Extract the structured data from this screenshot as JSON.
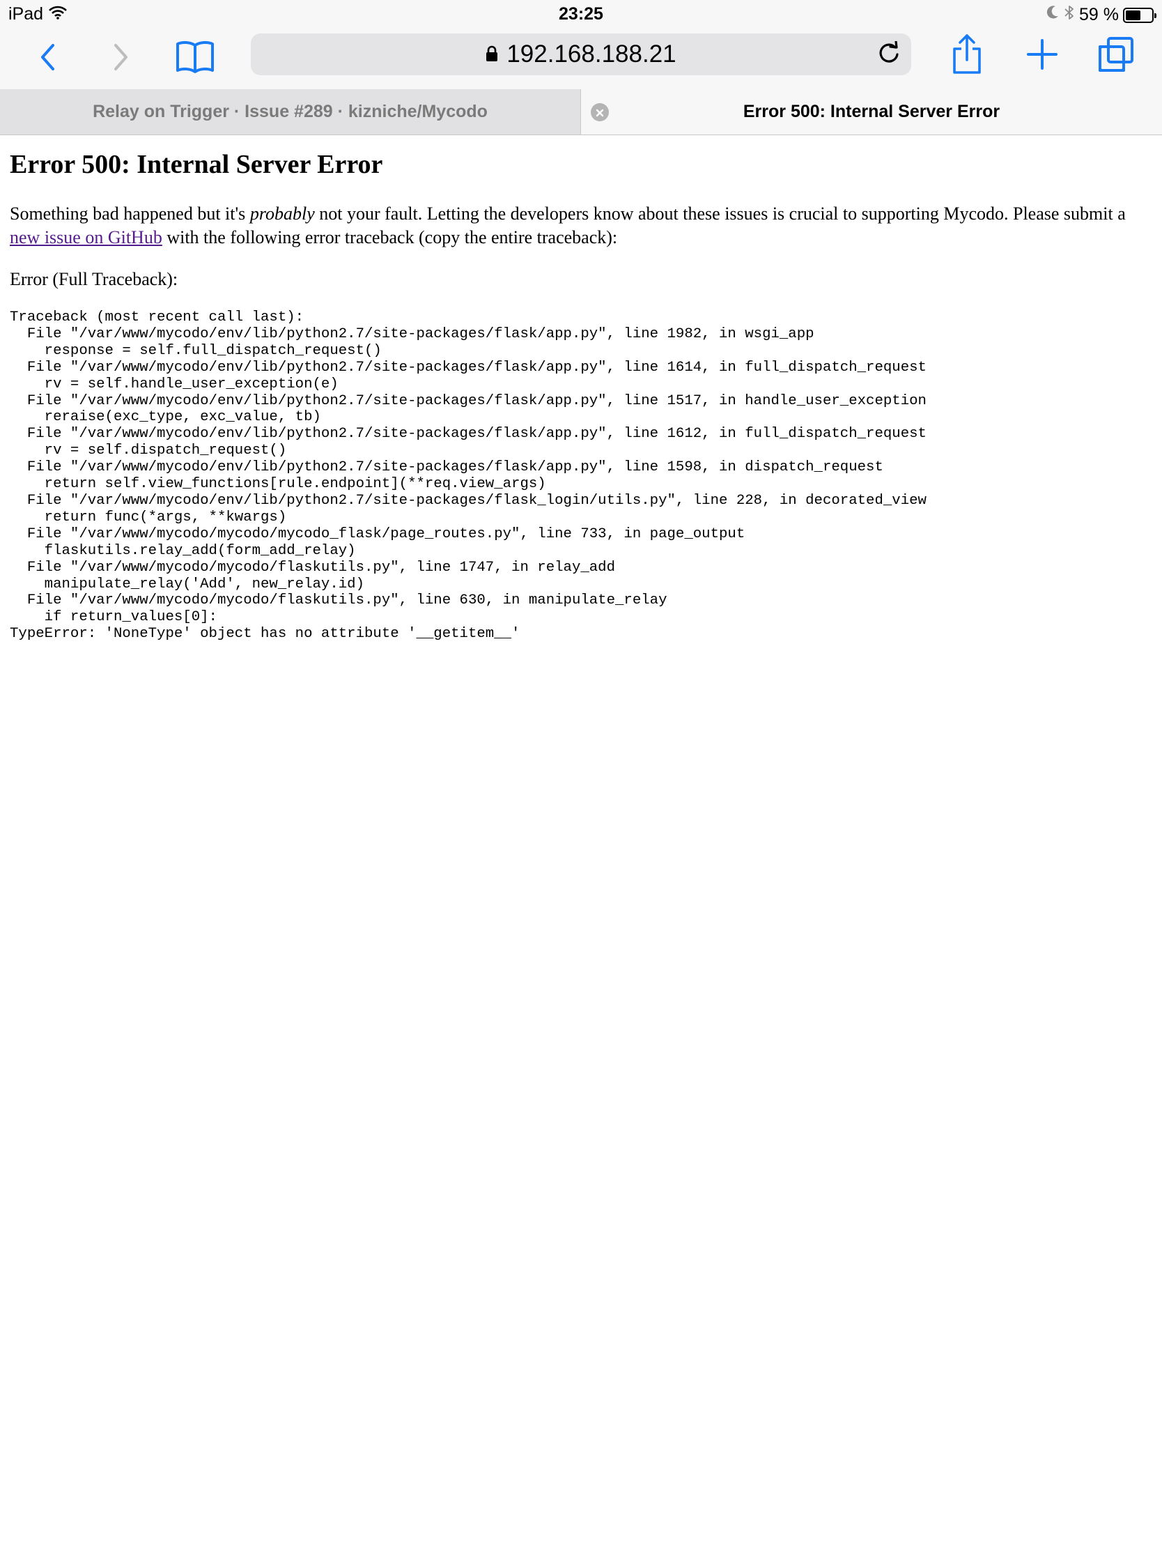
{
  "status_bar": {
    "device": "iPad",
    "time": "23:25",
    "battery_text": "59 %",
    "battery_level": 0.59,
    "icons": [
      "wifi-icon",
      "moon-icon",
      "bluetooth-icon",
      "battery-icon"
    ]
  },
  "toolbar": {
    "address": "192.168.188.21",
    "icons": [
      "back-icon",
      "forward-icon",
      "bookmarks-icon",
      "lock-icon",
      "reload-icon",
      "share-icon",
      "new-tab-icon",
      "tabs-icon"
    ],
    "accent_color": "#1a7cf5"
  },
  "tabs": [
    {
      "title": "Relay on Trigger · Issue #289 · kizniche/Mycodo",
      "active": false
    },
    {
      "title": "Error 500: Internal Server Error",
      "active": true
    }
  ],
  "page": {
    "heading": "Error 500: Internal Server Error",
    "intro_part1": "Something bad happened but it's ",
    "intro_emphasis": "probably",
    "intro_part2": " not your fault. Letting the developers know about these issues is crucial to supporting Mycodo. Please submit a ",
    "intro_link": "new issue on GitHub",
    "intro_part3": " with the following error traceback (copy the entire traceback):",
    "traceback_label": "Error (Full Traceback):",
    "traceback_lines": [
      "Traceback (most recent call last):",
      "  File \"/var/www/mycodo/env/lib/python2.7/site-packages/flask/app.py\", line 1982, in wsgi_app",
      "    response = self.full_dispatch_request()",
      "  File \"/var/www/mycodo/env/lib/python2.7/site-packages/flask/app.py\", line 1614, in full_dispatch_request",
      "    rv = self.handle_user_exception(e)",
      "  File \"/var/www/mycodo/env/lib/python2.7/site-packages/flask/app.py\", line 1517, in handle_user_exception",
      "    reraise(exc_type, exc_value, tb)",
      "  File \"/var/www/mycodo/env/lib/python2.7/site-packages/flask/app.py\", line 1612, in full_dispatch_request",
      "    rv = self.dispatch_request()",
      "  File \"/var/www/mycodo/env/lib/python2.7/site-packages/flask/app.py\", line 1598, in dispatch_request",
      "    return self.view_functions[rule.endpoint](**req.view_args)",
      "  File \"/var/www/mycodo/env/lib/python2.7/site-packages/flask_login/utils.py\", line 228, in decorated_view",
      "    return func(*args, **kwargs)",
      "  File \"/var/www/mycodo/mycodo/mycodo_flask/page_routes.py\", line 733, in page_output",
      "    flaskutils.relay_add(form_add_relay)",
      "  File \"/var/www/mycodo/mycodo/flaskutils.py\", line 1747, in relay_add",
      "    manipulate_relay('Add', new_relay.id)",
      "  File \"/var/www/mycodo/mycodo/flaskutils.py\", line 630, in manipulate_relay",
      "    if return_values[0]:",
      "TypeError: 'NoneType' object has no attribute '__getitem__'"
    ]
  }
}
